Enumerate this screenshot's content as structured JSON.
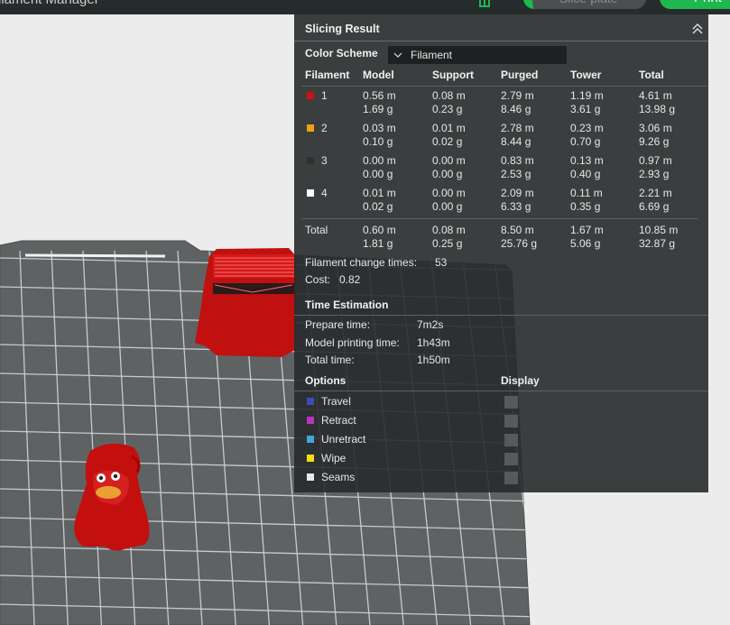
{
  "app": {
    "title": "ilament Manager",
    "slice_label": "Slice plate",
    "print_label": "Print"
  },
  "panel": {
    "title": "Slicing Result",
    "color_scheme_label": "Color Scheme",
    "color_scheme_value": "Filament",
    "columns": [
      "Filament",
      "Model",
      "Support",
      "Purged",
      "Tower",
      "Total"
    ],
    "rows": [
      {
        "id": "1",
        "color": "#d01010",
        "model": [
          "0.56 m",
          "1.69 g"
        ],
        "support": [
          "0.08 m",
          "0.23 g"
        ],
        "purged": [
          "2.79 m",
          "8.46 g"
        ],
        "tower": [
          "1.19 m",
          "3.61 g"
        ],
        "total": [
          "4.61 m",
          "13.98 g"
        ]
      },
      {
        "id": "2",
        "color": "#f0a010",
        "model": [
          "0.03 m",
          "0.10 g"
        ],
        "support": [
          "0.01 m",
          "0.02 g"
        ],
        "purged": [
          "2.78 m",
          "8.44 g"
        ],
        "tower": [
          "0.23 m",
          "0.70 g"
        ],
        "total": [
          "3.06 m",
          "9.26 g"
        ]
      },
      {
        "id": "3",
        "color": "#303030",
        "model": [
          "0.00 m",
          "0.00 g"
        ],
        "support": [
          "0.00 m",
          "0.00 g"
        ],
        "purged": [
          "0.83 m",
          "2.53 g"
        ],
        "tower": [
          "0.13 m",
          "0.40 g"
        ],
        "total": [
          "0.97 m",
          "2.93 g"
        ]
      },
      {
        "id": "4",
        "color": "#ffffff",
        "model": [
          "0.01 m",
          "0.02 g"
        ],
        "support": [
          "0.00 m",
          "0.00 g"
        ],
        "purged": [
          "2.09 m",
          "6.33 g"
        ],
        "tower": [
          "0.11 m",
          "0.35 g"
        ],
        "total": [
          "2.21 m",
          "6.69 g"
        ]
      }
    ],
    "total_row": {
      "label": "Total",
      "model": [
        "0.60 m",
        "1.81 g"
      ],
      "support": [
        "0.08 m",
        "0.25 g"
      ],
      "purged": [
        "8.50 m",
        "25.76 g"
      ],
      "tower": [
        "1.67 m",
        "5.06 g"
      ],
      "total": [
        "10.85 m",
        "32.87 g"
      ]
    },
    "filament_change_label": "Filament change times:",
    "filament_change_value": "53",
    "cost_label": "Cost:",
    "cost_value": "0.82",
    "time_title": "Time Estimation",
    "prepare_label": "Prepare time:",
    "prepare_value": "7m2s",
    "model_time_label": "Model printing time:",
    "model_time_value": "1h43m",
    "total_time_label": "Total time:",
    "total_time_value": "1h50m",
    "options_title": "Options",
    "display_title": "Display",
    "options": [
      {
        "label": "Travel",
        "color": "#3a4fb0"
      },
      {
        "label": "Retract",
        "color": "#c030c0"
      },
      {
        "label": "Unretract",
        "color": "#40a8d8"
      },
      {
        "label": "Wipe",
        "color": "#f0e010"
      },
      {
        "label": "Seams",
        "color": "#e8e8e8"
      }
    ]
  }
}
